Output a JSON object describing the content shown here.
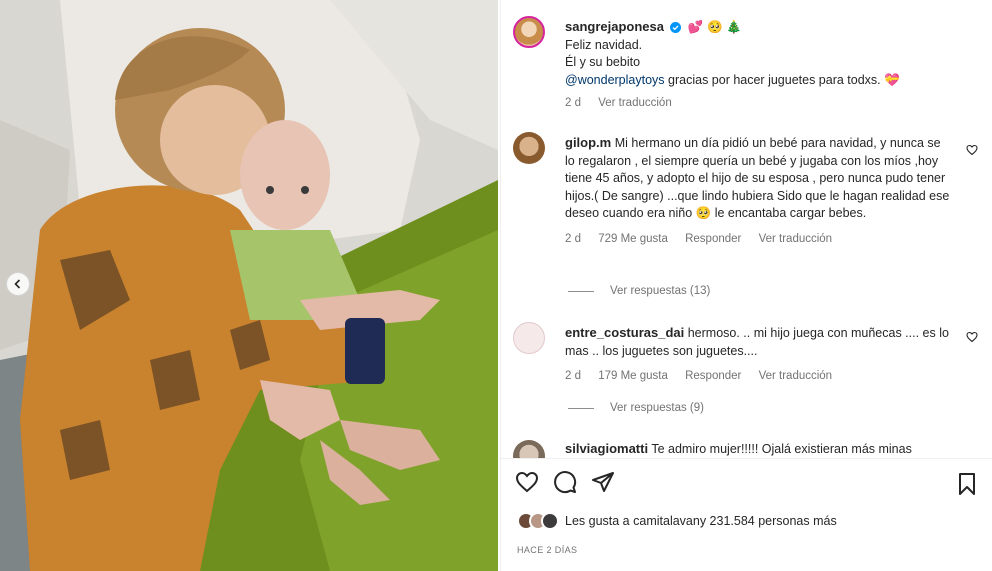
{
  "post": {
    "author": "sangrejaponesa",
    "author_emojis": "💕 🥺 🎄",
    "caption_line1": "Feliz navidad.",
    "caption_line2": "Él y su bebito",
    "caption_mention": "@wonderplaytoys",
    "caption_line3": " gracias por hacer juguetes para todxs. 💝",
    "time": "2 d",
    "translate": "Ver traducción"
  },
  "comments": [
    {
      "user": "gilop.m",
      "text": "Mi hermano un día pidió un bebé para navidad, y nunca se lo regalaron , el siempre quería un bebé y jugaba con los míos ,hoy tiene 45 años, y adopto el hijo de su esposa , pero nunca pudo tener hijos.( De sangre) ...que lindo hubiera Sido que le hagan realidad ese deseo cuando era niño 🥺 le encantaba cargar bebes.",
      "time": "2 d",
      "likes": "729 Me gusta",
      "reply": "Responder",
      "translate": "Ver traducción",
      "replies": "Ver respuestas (13)"
    },
    {
      "user": "entre_costuras_dai",
      "text": "hermoso. .. mi hijo juega con muñecas .... es lo mas .. los juguetes son juguetes....",
      "time": "2 d",
      "likes": "179 Me gusta",
      "reply": "Responder",
      "translate": "Ver traducción",
      "replies": "Ver respuestas (9)"
    },
    {
      "user": "silviagiomatti",
      "text": "Te admiro mujer!!!!! Ojalá existieran más minas"
    }
  ],
  "footer": {
    "likes_prefix": "Les gusta a ",
    "likes_user": "camitalavan",
    "likes_suffix": " y 231.584 personas más",
    "time_ago": "HACE 2 DÍAS"
  },
  "icons": [
    "heart-icon",
    "comment-icon",
    "share-icon",
    "bookmark-icon",
    "verified-icon",
    "chevron-left-icon"
  ],
  "colors": {
    "verified": "#0095f6",
    "mention": "#00376b",
    "muted": "#737373"
  }
}
